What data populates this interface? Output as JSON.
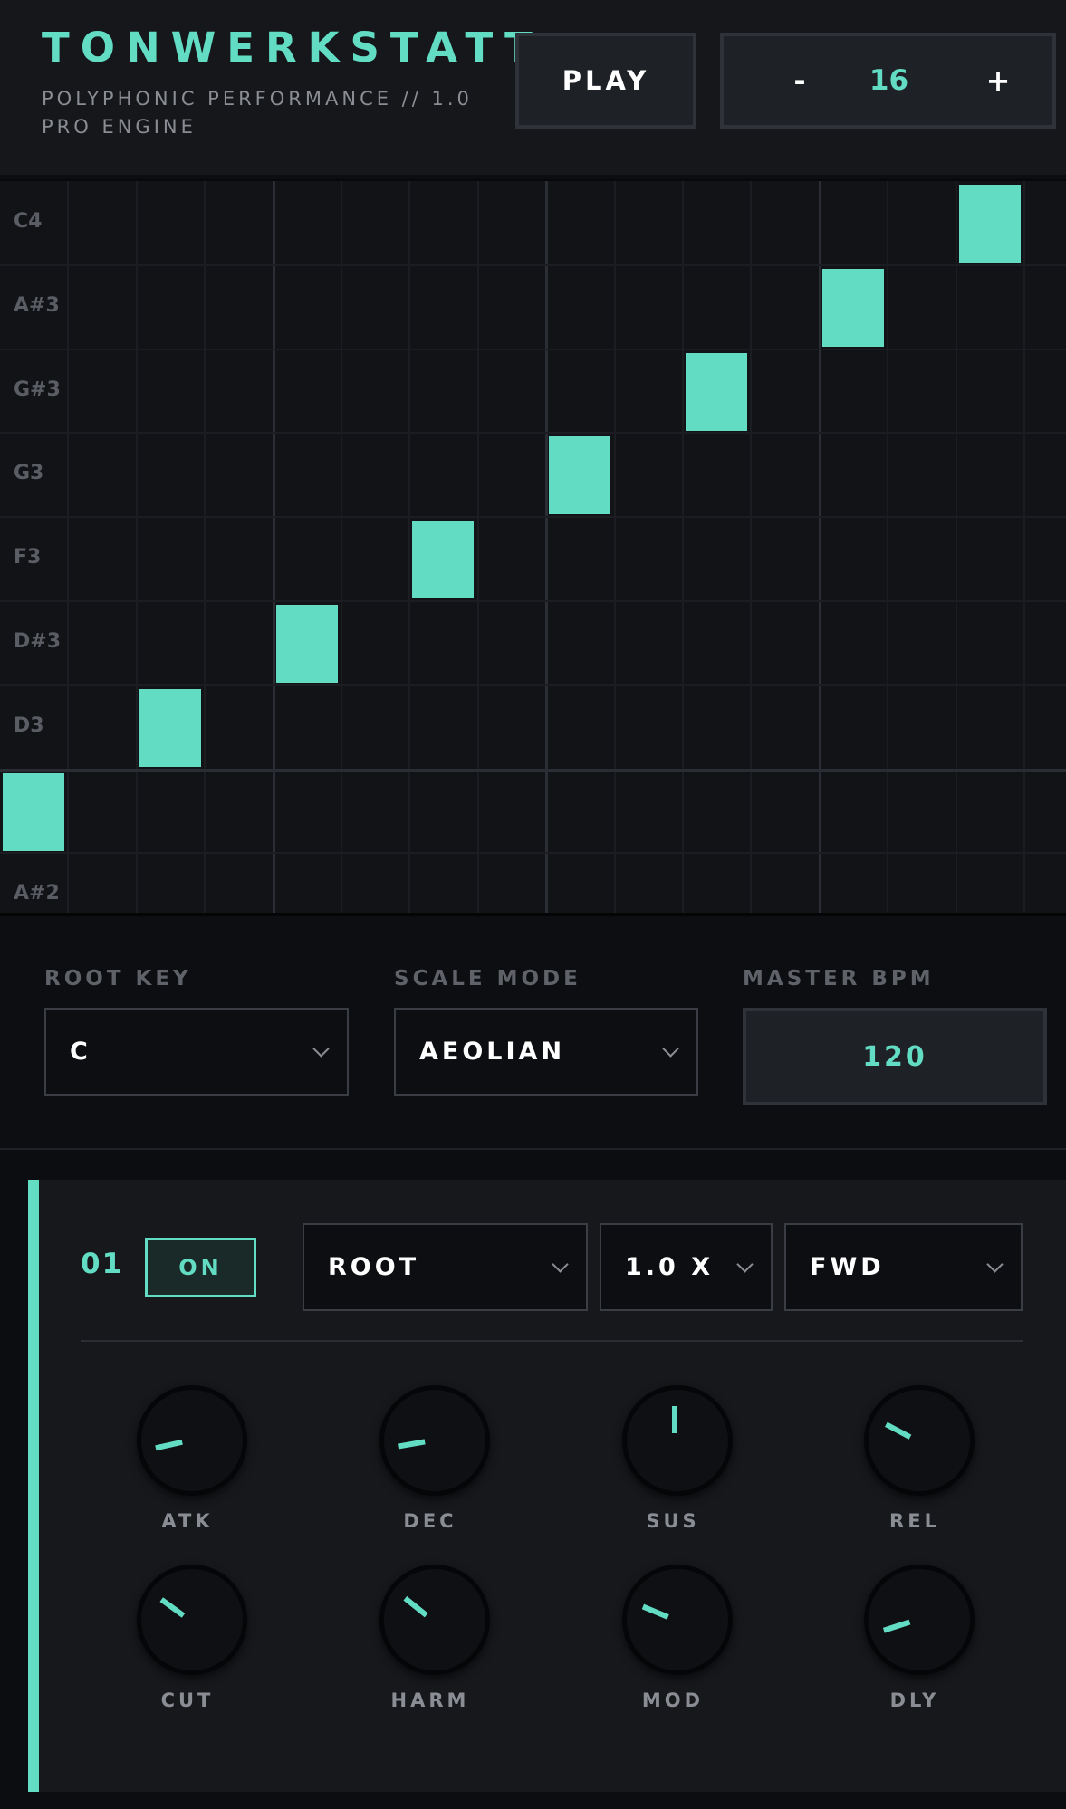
{
  "header": {
    "title": "TONWERKSTATT",
    "subtitle": "POLYPHONIC PERFORMANCE // 1.0 PRO ENGINE",
    "play_label": "PLAY",
    "stepper": {
      "minus": "-",
      "value": "16",
      "plus": "+"
    }
  },
  "grid": {
    "row_labels": [
      "C4",
      "A#3",
      "G#3",
      "G3",
      "F3",
      "D#3",
      "D3",
      "",
      "A#2"
    ],
    "steps_visible": 16,
    "active_notes": [
      {
        "step": 1,
        "note": "C3"
      },
      {
        "step": 3,
        "note": "D3"
      },
      {
        "step": 5,
        "note": "D#3"
      },
      {
        "step": 7,
        "note": "F3"
      },
      {
        "step": 9,
        "note": "G3"
      },
      {
        "step": 11,
        "note": "G#3"
      },
      {
        "step": 13,
        "note": "A#3"
      },
      {
        "step": 15,
        "note": "C4"
      }
    ]
  },
  "controls": {
    "root_key": {
      "label": "ROOT KEY",
      "value": "C"
    },
    "scale_mode": {
      "label": "SCALE MODE",
      "value": "AEOLIAN"
    },
    "master_bpm": {
      "label": "MASTER BPM",
      "value": "120"
    }
  },
  "track": {
    "number": "01",
    "on_label": "ON",
    "source": "ROOT",
    "rate": "1.0 X",
    "direction": "FWD",
    "knobs": [
      {
        "label": "ATK",
        "value": 0.12
      },
      {
        "label": "DEC",
        "value": 0.13
      },
      {
        "label": "SUS",
        "value": 0.5
      },
      {
        "label": "REL",
        "value": 0.27
      },
      {
        "label": "CUT",
        "value": 0.3
      },
      {
        "label": "HARM",
        "value": 0.31
      },
      {
        "label": "MOD",
        "value": 0.25
      },
      {
        "label": "DLY",
        "value": 0.1
      }
    ]
  },
  "colors": {
    "accent": "#63dcc4",
    "background": "#0c0d10",
    "panel": "#16181c"
  }
}
